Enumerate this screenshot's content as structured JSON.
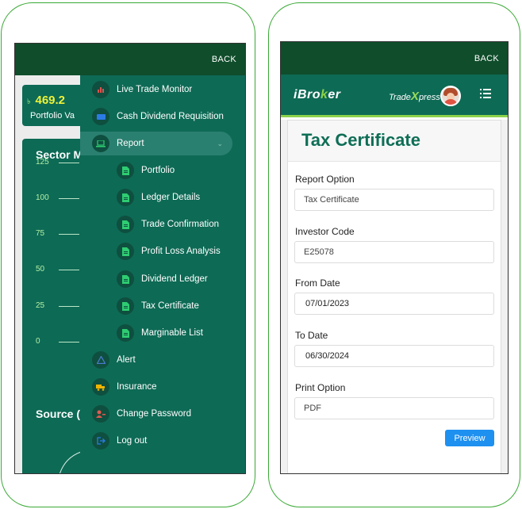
{
  "left_screen": {
    "back_label": "BACK",
    "portfolio": {
      "value": "469.2",
      "currency_symbol": "৳",
      "label": "Portfolio Va"
    },
    "sector_title": "Sector M",
    "y_ticks": [
      "125",
      "100",
      "75",
      "50",
      "25",
      "0"
    ],
    "source_title": "Source (",
    "menu": {
      "items": [
        {
          "label": "Live Trade Monitor",
          "icon": "bar-chart-icon",
          "icon_color": "#d9534f"
        },
        {
          "label": "Cash Dividend Requisition",
          "icon": "card-icon",
          "icon_color": "#2c7be5"
        },
        {
          "label": "Report",
          "icon": "laptop-icon",
          "icon_color": "#2ecc71",
          "active": true
        },
        {
          "label": "Portfolio",
          "icon": "document-icon",
          "icon_color": "#2ecc71",
          "sub": true
        },
        {
          "label": "Ledger Details",
          "icon": "document-icon",
          "icon_color": "#2ecc71",
          "sub": true
        },
        {
          "label": "Trade Confirmation",
          "icon": "document-icon",
          "icon_color": "#2ecc71",
          "sub": true
        },
        {
          "label": "Profit Loss Analysis",
          "icon": "document-icon",
          "icon_color": "#2ecc71",
          "sub": true
        },
        {
          "label": "Dividend Ledger",
          "icon": "document-icon",
          "icon_color": "#2ecc71",
          "sub": true
        },
        {
          "label": "Tax Certificate",
          "icon": "document-icon",
          "icon_color": "#2ecc71",
          "sub": true
        },
        {
          "label": "Marginable List",
          "icon": "document-icon",
          "icon_color": "#2ecc71",
          "sub": true
        },
        {
          "label": "Alert",
          "icon": "warning-icon",
          "icon_color": "#4a7bd0"
        },
        {
          "label": "Insurance",
          "icon": "truck-icon",
          "icon_color": "#f0b400"
        },
        {
          "label": "Change Password",
          "icon": "user-key-icon",
          "icon_color": "#e05a4f"
        },
        {
          "label": "Log out",
          "icon": "logout-icon",
          "icon_color": "#2c7be5"
        }
      ]
    }
  },
  "right_screen": {
    "back_label": "BACK",
    "logo_left": {
      "prefix": "iBro",
      "highlight": "k",
      "suffix": "er"
    },
    "logo_right": {
      "prefix": "Trade",
      "highlight": "X",
      "suffix": "press"
    },
    "form": {
      "title": "Tax Certificate",
      "fields": [
        {
          "label": "Report Option",
          "value": "Tax Certificate",
          "type": "select"
        },
        {
          "label": "Investor Code",
          "value": "E25078",
          "type": "text"
        },
        {
          "label": "From Date",
          "value": "07/01/2023",
          "type": "date"
        },
        {
          "label": "To Date",
          "value": "06/30/2024",
          "type": "date"
        },
        {
          "label": "Print Option",
          "value": "PDF",
          "type": "select"
        }
      ],
      "preview_label": "Preview"
    }
  }
}
